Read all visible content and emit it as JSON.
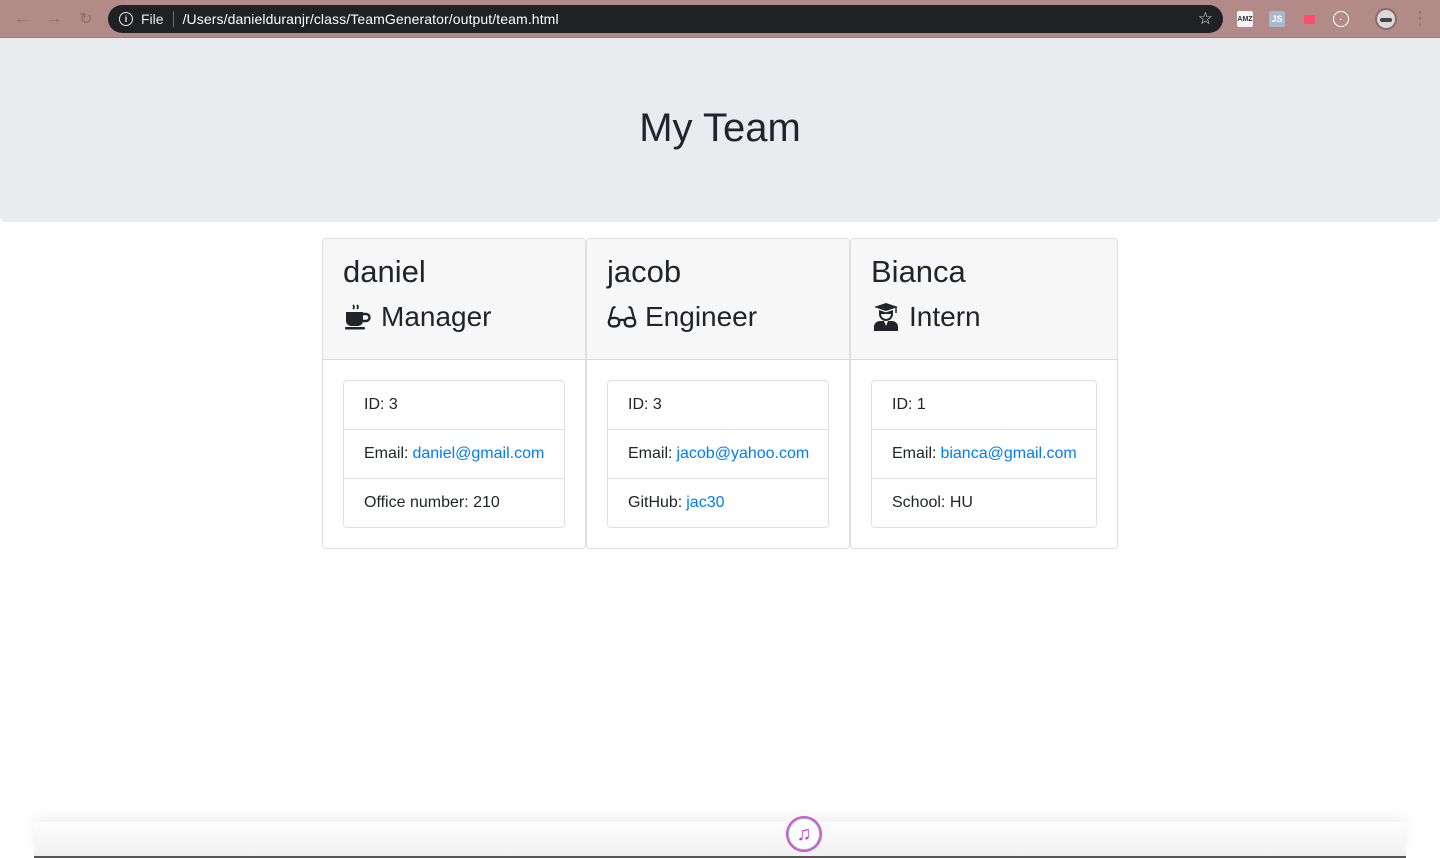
{
  "browser": {
    "scheme_label": "File",
    "url": "/Users/danielduranjr/class/TeamGenerator/output/team.html",
    "extensions": [
      "AMZ",
      "JS"
    ]
  },
  "page": {
    "title": "My Team"
  },
  "team": [
    {
      "name": "daniel",
      "role": "Manager",
      "role_icon": "mug-icon",
      "id_label": "ID: 3",
      "email_label": "Email:",
      "email": "daniel@gmail.com",
      "extra_label": "Office number: 210",
      "extra_link": ""
    },
    {
      "name": "jacob",
      "role": "Engineer",
      "role_icon": "glasses-icon",
      "id_label": "ID: 3",
      "email_label": "Email:",
      "email": "jacob@yahoo.com",
      "extra_label": "GitHub:",
      "extra_link": "jac30"
    },
    {
      "name": "Bianca",
      "role": "Intern",
      "role_icon": "graduate-icon",
      "id_label": "ID: 1",
      "email_label": "Email:",
      "email": "bianca@gmail.com",
      "extra_label": "School: HU",
      "extra_link": ""
    }
  ],
  "colors": {
    "link": "#007bff",
    "jumbotron_bg": "#e9ecef",
    "card_header_bg": "#f7f7f7",
    "chrome_bg": "#b28a88"
  }
}
